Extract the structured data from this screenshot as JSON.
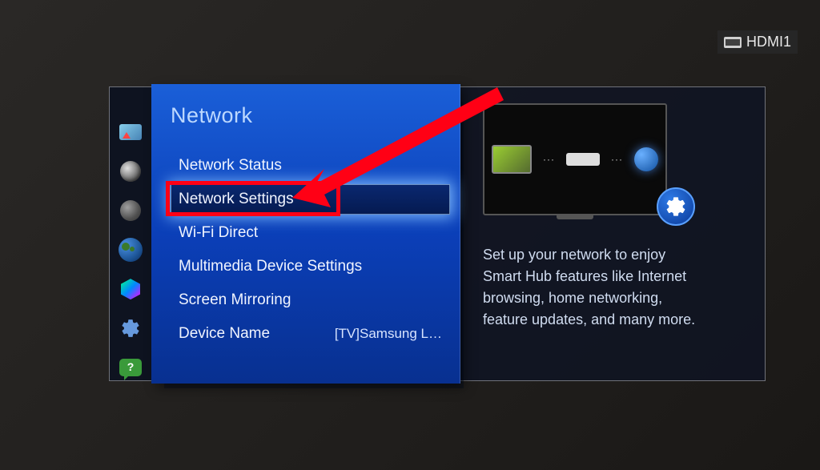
{
  "input_source": "HDMI1",
  "panel": {
    "title": "Network",
    "items": [
      {
        "label": "Network Status",
        "value": "",
        "selected": false
      },
      {
        "label": "Network Settings",
        "value": "",
        "selected": true,
        "highlighted": true
      },
      {
        "label": "Wi-Fi Direct",
        "value": "",
        "selected": false
      },
      {
        "label": "Multimedia Device Settings",
        "value": "",
        "selected": false
      },
      {
        "label": "Screen Mirroring",
        "value": "",
        "selected": false
      },
      {
        "label": "Device Name",
        "value": "[TV]Samsung L…",
        "selected": false
      }
    ]
  },
  "info": {
    "description": "Set up your network to enjoy Smart Hub features like Internet browsing, home networking, feature updates, and many more."
  },
  "sidebar": {
    "icons": [
      "picture",
      "sound",
      "broadcast",
      "network",
      "smart",
      "system",
      "support"
    ]
  },
  "colors": {
    "panel_blue": "#0b3fb8",
    "highlight_red": "#ff0015",
    "selected_glow": "#82beff"
  }
}
